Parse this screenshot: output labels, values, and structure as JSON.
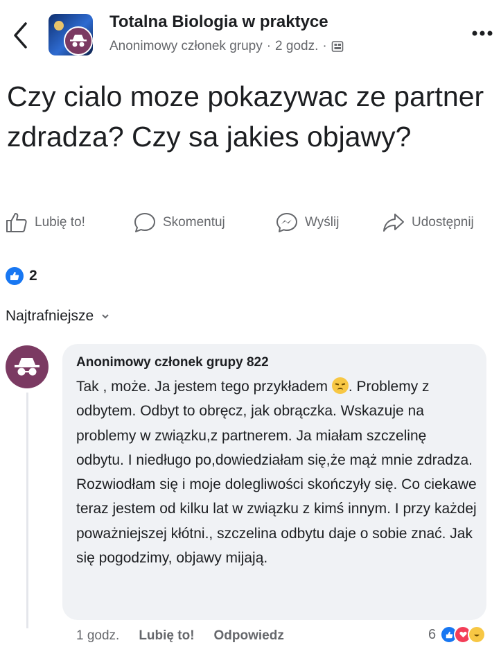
{
  "header": {
    "group_name": "Totalna Biologia w praktyce",
    "author": "Anonimowy członek grupy",
    "separator": "·",
    "time": "2 godz.",
    "separator2": "·"
  },
  "post": {
    "text": "Czy cialo moze pokazywac ze partner zdradza? Czy sa jakies objawy?"
  },
  "actions": {
    "like": "Lubię to!",
    "comment": "Skomentuj",
    "send": "Wyślij",
    "share": "Udostępnij"
  },
  "reactions": {
    "count": "2"
  },
  "comments_sort": {
    "label": "Najtrafniejsze"
  },
  "comment": {
    "author": "Anonimowy członek grupy 822",
    "text_before_emoji": "Tak , może. Ja jestem tego przykładem",
    "text_after_emoji": ". Problemy z odbytem. Odbyt to obręcz, jak obrączka. Wskazuje na problemy w związku,z partnerem. Ja miałam szczelinę odbytu. I niedługo po,dowiedziałam się,że mąż mnie zdradza. Rozwiodłam się i moje dolegliwości skończyły się. Co ciekawe teraz jestem od kilku lat w związku z kimś innym. I przy każdej poważniejszej kłótni., szczelina odbytu daje o sobie znać. Jak się pogodzimy, objawy mijają.",
    "time": "1 godz.",
    "like": "Lubię to!",
    "reply": "Odpowiedz",
    "reaction_count": "6"
  },
  "colors": {
    "facebook_blue": "#1877f2",
    "anon_avatar": "#7b3a62",
    "bubble": "#f0f2f5",
    "secondary_text": "#65676b",
    "haha": "#f7c744",
    "love": "#f33e58"
  },
  "icons": [
    "back-chevron-icon",
    "anonymous-icon",
    "globe-icon",
    "more-icon",
    "like-icon",
    "comment-icon",
    "messenger-icon",
    "share-icon",
    "sad-emoji-icon",
    "chevron-down-icon"
  ]
}
